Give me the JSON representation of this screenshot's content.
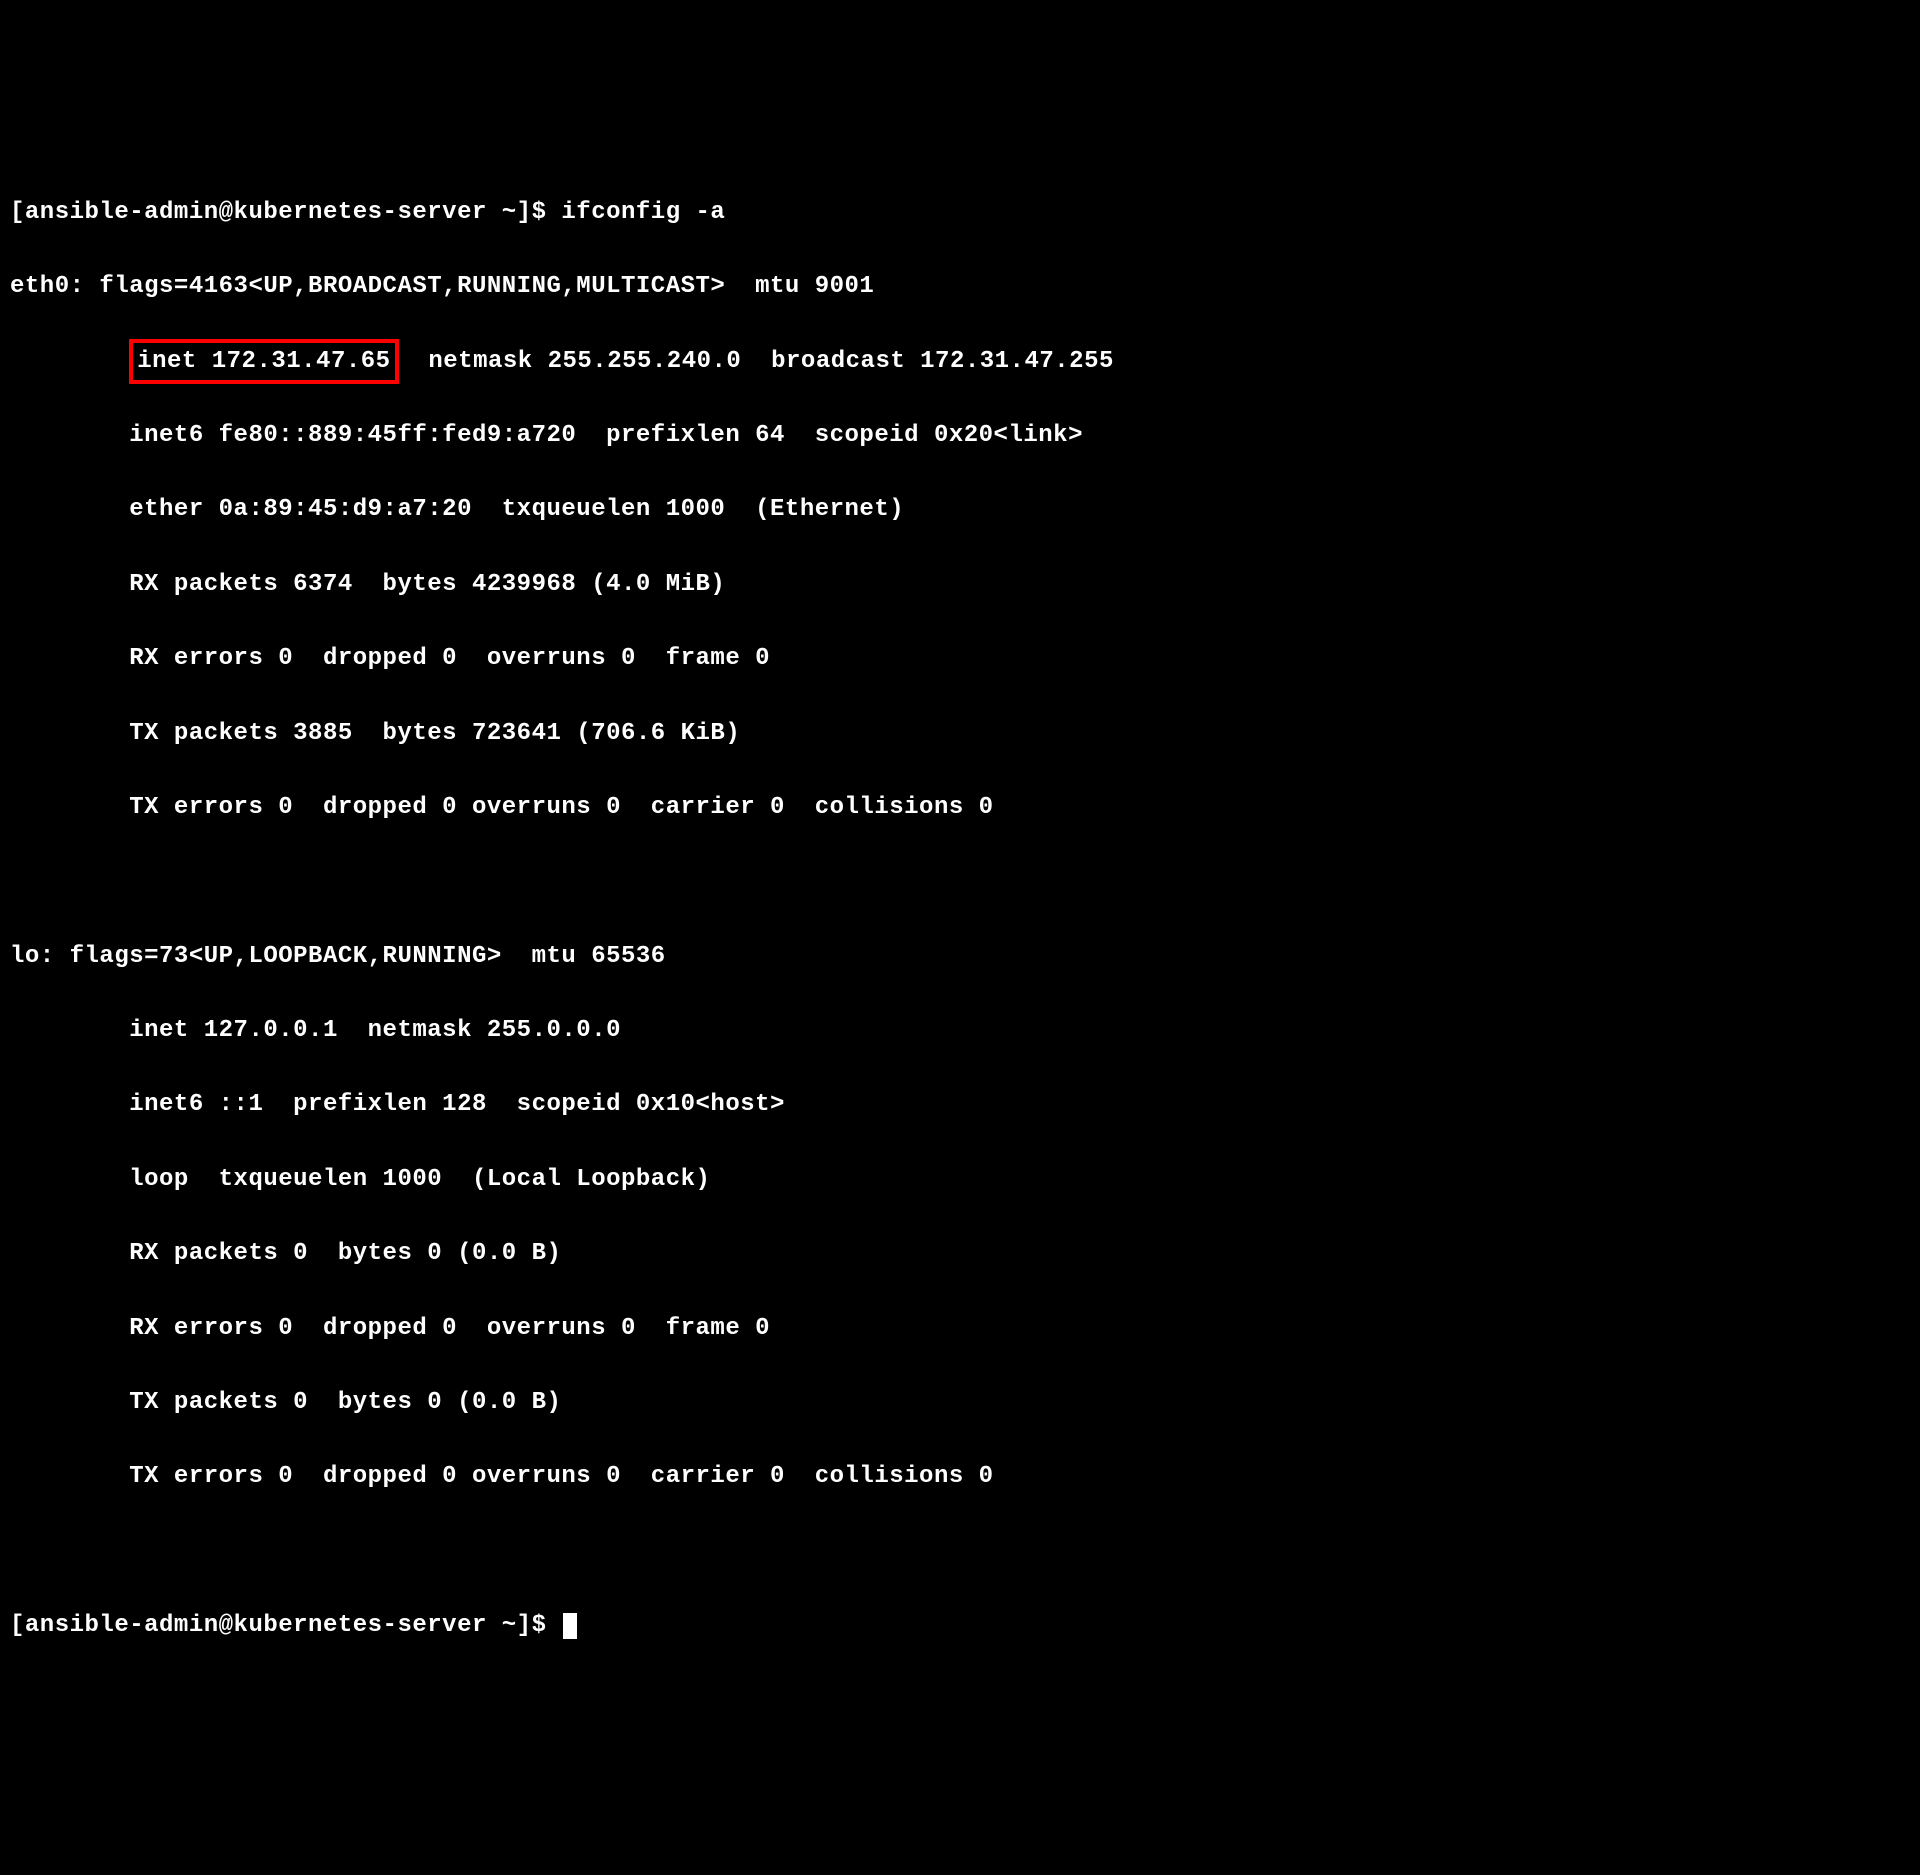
{
  "prompt1": {
    "user_host": "[ansible-admin@kubernetes-server ~]$ ",
    "command": "ifconfig -a"
  },
  "eth0": {
    "header": "eth0: flags=4163<UP,BROADCAST,RUNNING,MULTICAST>  mtu 9001",
    "inet_prefix": "        ",
    "inet_highlight": "inet 172.31.47.65",
    "inet_rest": "  netmask 255.255.240.0  broadcast 172.31.47.255",
    "inet6": "        inet6 fe80::889:45ff:fed9:a720  prefixlen 64  scopeid 0x20<link>",
    "ether": "        ether 0a:89:45:d9:a7:20  txqueuelen 1000  (Ethernet)",
    "rx_packets": "        RX packets 6374  bytes 4239968 (4.0 MiB)",
    "rx_errors": "        RX errors 0  dropped 0  overruns 0  frame 0",
    "tx_packets": "        TX packets 3885  bytes 723641 (706.6 KiB)",
    "tx_errors": "        TX errors 0  dropped 0 overruns 0  carrier 0  collisions 0"
  },
  "lo": {
    "header": "lo: flags=73<UP,LOOPBACK,RUNNING>  mtu 65536",
    "inet": "        inet 127.0.0.1  netmask 255.0.0.0",
    "inet6": "        inet6 ::1  prefixlen 128  scopeid 0x10<host>",
    "loop": "        loop  txqueuelen 1000  (Local Loopback)",
    "rx_packets": "        RX packets 0  bytes 0 (0.0 B)",
    "rx_errors": "        RX errors 0  dropped 0  overruns 0  frame 0",
    "tx_packets": "        TX packets 0  bytes 0 (0.0 B)",
    "tx_errors": "        TX errors 0  dropped 0 overruns 0  carrier 0  collisions 0"
  },
  "prompt2": "[ansible-admin@kubernetes-server ~]$ "
}
